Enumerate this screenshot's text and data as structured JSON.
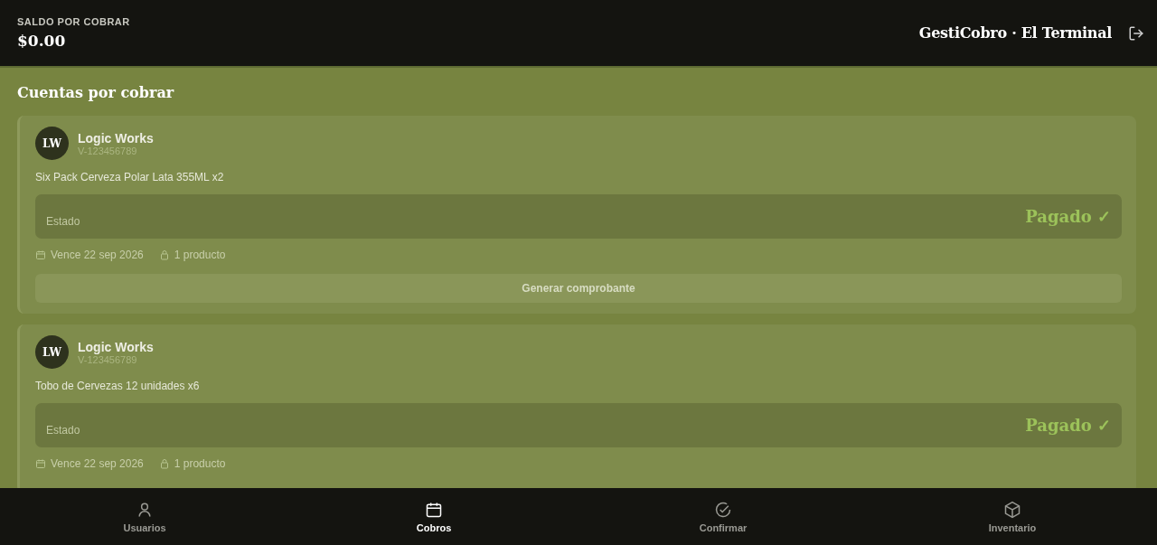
{
  "header": {
    "balance_label": "SALDO POR COBRAR",
    "balance": "$0.00",
    "title": "GestiCobro · El Terminal"
  },
  "section_title": "Cuentas por cobrar",
  "accounts": [
    {
      "initials": "LW",
      "client": "Logic Works",
      "client_id": "V-123456789",
      "description": "Six Pack Cerveza Polar Lata 355ML x2",
      "status_label": "Estado",
      "status": "Pagado ✓",
      "kind": "paid",
      "due": "Vence 22 sep 2026",
      "items": "1 producto",
      "button": "Generar comprobante"
    },
    {
      "initials": "LW",
      "client": "Logic Works",
      "client_id": "V-123456789",
      "description": "Tobo de Cervezas 12 unidades x6",
      "status_label": "Estado",
      "status": "Pagado ✓",
      "kind": "paid",
      "due": "Vence 22 sep 2026",
      "items": "1 producto"
    }
  ],
  "nav": [
    {
      "label": "Usuarios",
      "kind": "user",
      "selected": false
    },
    {
      "label": "Cobros",
      "kind": "calendar",
      "selected": true
    },
    {
      "label": "Confirmar",
      "kind": "check",
      "selected": false
    },
    {
      "label": "Inventario",
      "kind": "cube",
      "selected": false
    }
  ]
}
